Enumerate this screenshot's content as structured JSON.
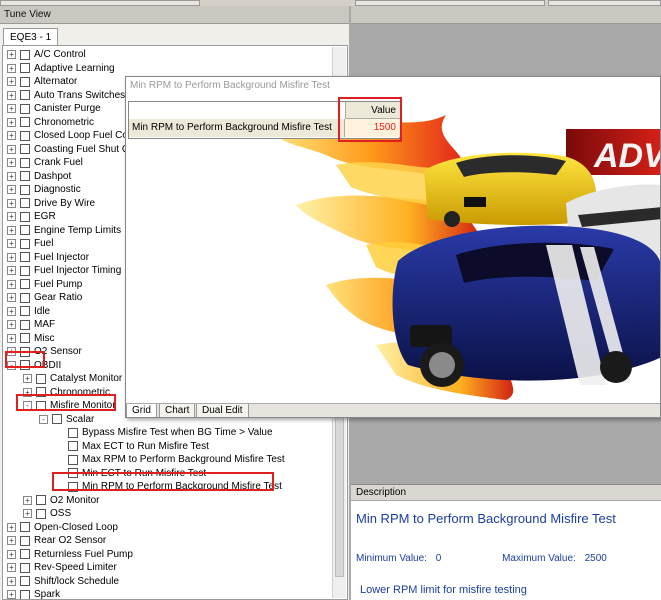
{
  "tune_view": {
    "title": "Tune View",
    "tab": "EQE3 - 1"
  },
  "tree": {
    "items": [
      {
        "label": "A/C Control",
        "depth": 0,
        "expander": "+"
      },
      {
        "label": "Adaptive Learning",
        "depth": 0,
        "expander": "+"
      },
      {
        "label": "Alternator",
        "depth": 0,
        "expander": "+"
      },
      {
        "label": "Auto Trans Switches",
        "depth": 0,
        "expander": "+"
      },
      {
        "label": "Canister Purge",
        "depth": 0,
        "expander": "+"
      },
      {
        "label": "Chronometric",
        "depth": 0,
        "expander": "+"
      },
      {
        "label": "Closed Loop Fuel Cor",
        "depth": 0,
        "expander": "+"
      },
      {
        "label": "Coasting Fuel Shut Of",
        "depth": 0,
        "expander": "+"
      },
      {
        "label": "Crank Fuel",
        "depth": 0,
        "expander": "+"
      },
      {
        "label": "Dashpot",
        "depth": 0,
        "expander": "+"
      },
      {
        "label": "Diagnostic",
        "depth": 0,
        "expander": "+"
      },
      {
        "label": "Drive By Wire",
        "depth": 0,
        "expander": "+"
      },
      {
        "label": "EGR",
        "depth": 0,
        "expander": "+"
      },
      {
        "label": "Engine Temp Limits",
        "depth": 0,
        "expander": "+"
      },
      {
        "label": "Fuel",
        "depth": 0,
        "expander": "+"
      },
      {
        "label": "Fuel Injector",
        "depth": 0,
        "expander": "+"
      },
      {
        "label": "Fuel Injector Timing",
        "depth": 0,
        "expander": "+"
      },
      {
        "label": "Fuel Pump",
        "depth": 0,
        "expander": "+"
      },
      {
        "label": "Gear Ratio",
        "depth": 0,
        "expander": "+"
      },
      {
        "label": "Idle",
        "depth": 0,
        "expander": "+"
      },
      {
        "label": "MAF",
        "depth": 0,
        "expander": "+"
      },
      {
        "label": "Misc",
        "depth": 0,
        "expander": "+"
      },
      {
        "label": "O2 Sensor",
        "depth": 0,
        "expander": "+"
      },
      {
        "label": "OBDII",
        "depth": 0,
        "expander": "-"
      },
      {
        "label": "Catalyst Monitor",
        "depth": 1,
        "expander": "+"
      },
      {
        "label": "Chronometric",
        "depth": 1,
        "expander": "+"
      },
      {
        "label": "Misfire Monitor",
        "depth": 1,
        "expander": "-"
      },
      {
        "label": "Scalar",
        "depth": 2,
        "expander": "-"
      },
      {
        "label": "Bypass Misfire Test when BG Time > Value",
        "depth": 3,
        "expander": ""
      },
      {
        "label": "Max ECT to Run Misfire Test",
        "depth": 3,
        "expander": ""
      },
      {
        "label": "Max RPM to Perform Background Misfire Test",
        "depth": 3,
        "expander": ""
      },
      {
        "label": "Min ECT to Run Misfire Test",
        "depth": 3,
        "expander": ""
      },
      {
        "label": "Min RPM to Perform Background Misfire Test",
        "depth": 3,
        "expander": ""
      },
      {
        "label": "O2 Monitor",
        "depth": 1,
        "expander": "+"
      },
      {
        "label": "OSS",
        "depth": 1,
        "expander": "+"
      },
      {
        "label": "Open-Closed Loop",
        "depth": 0,
        "expander": "+"
      },
      {
        "label": "Rear O2 Sensor",
        "depth": 0,
        "expander": "+"
      },
      {
        "label": "Returnless Fuel Pump",
        "depth": 0,
        "expander": "+"
      },
      {
        "label": "Rev-Speed Limiter",
        "depth": 0,
        "expander": "+"
      },
      {
        "label": "Shift/lock Schedule",
        "depth": 0,
        "expander": "+"
      },
      {
        "label": "Spark",
        "depth": 0,
        "expander": "+"
      }
    ]
  },
  "editor": {
    "title": "Min RPM to Perform Background Misfire Test",
    "column_header": "Value",
    "row_label": "Min RPM to Perform Background Misfire Test",
    "value": "1500",
    "art_text": "ADV",
    "tabs": [
      "Grid",
      "Chart",
      "Dual Edit"
    ],
    "active_tab": "Grid"
  },
  "description": {
    "header": "Description",
    "title": "Min RPM to Perform Background Misfire Test",
    "min_label": "Minimum Value:",
    "min_value": "0",
    "max_label": "Maximum Value:",
    "max_value": "2500",
    "text": "Lower RPM limit for misfire testing"
  },
  "colors": {
    "highlight": "#e02020",
    "description_text": "#1b3ea0",
    "value_text": "#e0201c"
  }
}
